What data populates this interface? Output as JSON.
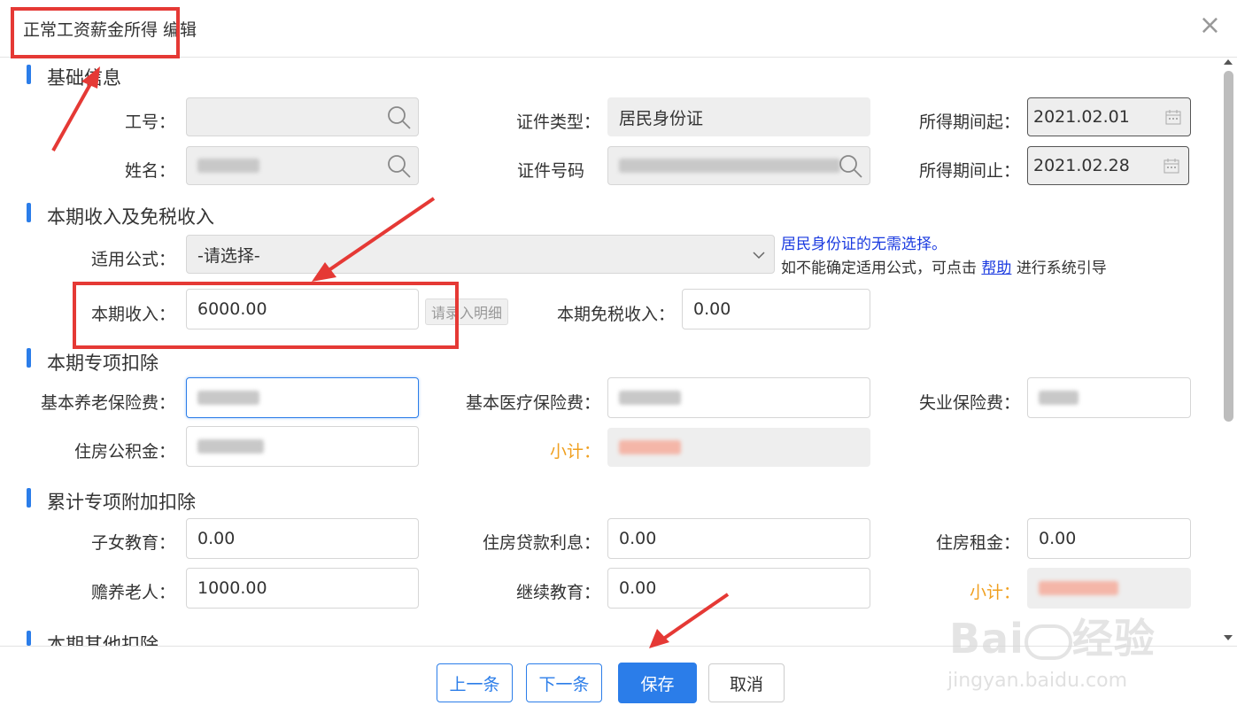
{
  "dialog": {
    "title": "正常工资薪金所得 编辑",
    "close_icon": "×"
  },
  "sections": {
    "basic": "基础信息",
    "income": "本期收入及免税收入",
    "special": "本期专项扣除",
    "cumulative": "累计专项附加扣除",
    "other": "本期其他扣除"
  },
  "basic": {
    "employee_id_label": "工号：",
    "employee_id_value": "",
    "name_label": "姓名：",
    "id_type_label": "证件类型：",
    "id_type_value": "居民身份证",
    "id_number_label": "证件号码",
    "period_start_label": "所得期间起：",
    "period_start_value": "2021.02.01",
    "period_end_label": "所得期间止：",
    "period_end_value": "2021.02.28"
  },
  "income": {
    "formula_label": "适用公式：",
    "formula_value": "-请选择-",
    "hint_line1": "居民身份证的无需选择。",
    "hint_line2_pre": "如不能确定适用公式，可点击",
    "hint_link": "帮助",
    "hint_line2_post": "进行系统引导",
    "current_income_label": "本期收入：",
    "current_income_value": "6000.00",
    "detail_button": "请录入明细",
    "tax_free_label": "本期免税收入：",
    "tax_free_value": "0.00"
  },
  "special": {
    "pension_label": "基本养老保险费：",
    "medical_label": "基本医疗保险费：",
    "unemployment_label": "失业保险费：",
    "housing_fund_label": "住房公积金：",
    "subtotal_label": "小计："
  },
  "cumulative": {
    "children_label": "子女教育：",
    "children_value": "0.00",
    "mortgage_label": "住房贷款利息：",
    "mortgage_value": "0.00",
    "rent_label": "住房租金：",
    "rent_value": "0.00",
    "elderly_label": "赡养老人：",
    "elderly_value": "1000.00",
    "continuing_edu_label": "继续教育：",
    "continuing_edu_value": "0.00",
    "subtotal_label": "小计："
  },
  "footer": {
    "prev": "上一条",
    "next": "下一条",
    "save": "保存",
    "cancel": "取消"
  },
  "watermark": {
    "brand": "Bai",
    "brand_cn": "经验",
    "url": "jingyan.baidu.com"
  },
  "colors": {
    "accent": "#2b7de9",
    "annotation": "#e53935",
    "subtotal": "#f0a020",
    "hint": "#1a3ae0"
  }
}
